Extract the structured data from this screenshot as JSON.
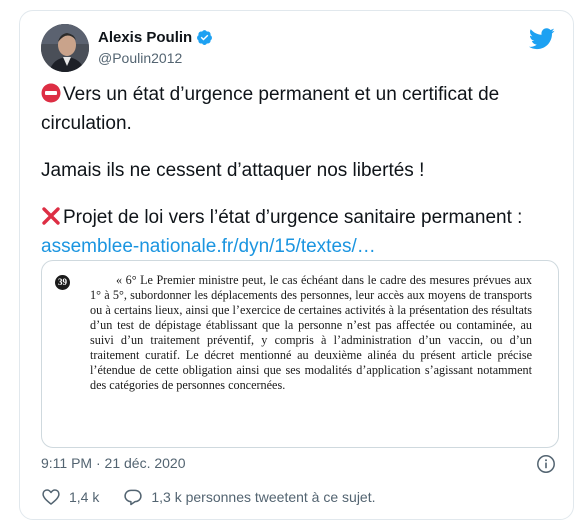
{
  "author": {
    "name": "Alexis Poulin",
    "handle": "@Poulin2012",
    "verified": true
  },
  "tweet": {
    "line1": "Vers un état d’urgence permanent et un  certificat de",
    "line2": "circulation.",
    "line3": "Jamais ils ne cessent d’attaquer nos libertés !",
    "line4": "Projet de loi vers l’état d’urgence sanitaire permanent :",
    "link": "assemblee-nationale.fr/dyn/15/textes/…",
    "emoji1": "no-entry-icon",
    "emoji2": "cross-mark-icon"
  },
  "document": {
    "number": "39",
    "text": "« 6° Le Premier ministre peut, le cas échéant dans le cadre des mesures prévues aux 1° à 5°, subordonner les déplacements des personnes, leur accès aux moyens de transports ou à certains lieux, ainsi que l’exercice de certaines activités à la présentation des résultats d’un test de dépistage établissant que la personne n’est pas affectée ou contaminée, au suivi d’un traitement préventif, y compris à l’administration d’un vaccin, ou d’un traitement curatif. Le décret mentionné au deuxième alinéa du présent article précise l’étendue de cette obligation ainsi que ses modalités d’application s’agissant notamment des catégories de personnes concernées."
  },
  "meta": {
    "timestamp": "9:11 PM · 21 déc. 2020"
  },
  "actions": {
    "likes": "1,4 k",
    "replies": "1,3 k personnes tweetent à ce sujet."
  },
  "colors": {
    "link": "#1b95e0",
    "twitter_blue": "#1da1f2",
    "secondary_text": "#536471"
  }
}
